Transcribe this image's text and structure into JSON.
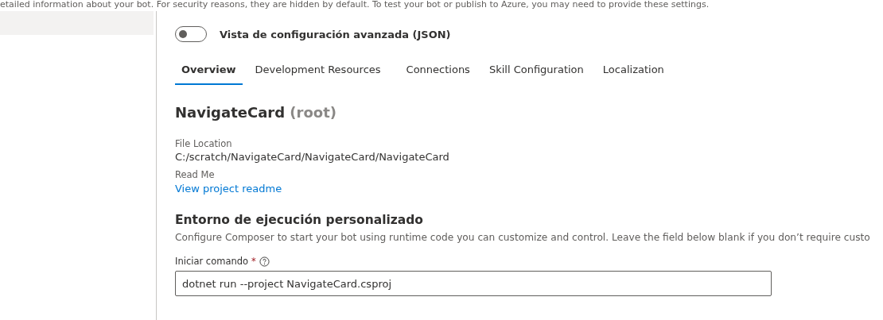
{
  "notice": "etailed information about your bot. For security reasons, they are hidden by default. To test your bot or publish to Azure, you may need to provide these settings.",
  "advanced_toggle": {
    "label": "Vista de configuración avanzada (JSON)",
    "on": false
  },
  "tabs": [
    {
      "label": "Overview",
      "selected": true
    },
    {
      "label": "Development Resources",
      "selected": false
    },
    {
      "label": "Connections",
      "selected": false
    },
    {
      "label": "Skill Configuration",
      "selected": false
    },
    {
      "label": "Localization",
      "selected": false
    }
  ],
  "bot": {
    "name": "NavigateCard",
    "suffix": "(root)"
  },
  "file_location": {
    "label": "File Location",
    "value": "C:/scratch/NavigateCard/NavigateCard/NavigateCard"
  },
  "read_me": {
    "label": "Read Me",
    "link": "View project readme"
  },
  "runtime": {
    "title": "Entorno de ejecución personalizado",
    "description": "Configure Composer to start your bot using runtime code you can customize and control. Leave the field below blank if you don’t require custo",
    "field_label": "Iniciar comando",
    "required_mark": "*",
    "value": "dotnet run --project NavigateCard.csproj"
  }
}
